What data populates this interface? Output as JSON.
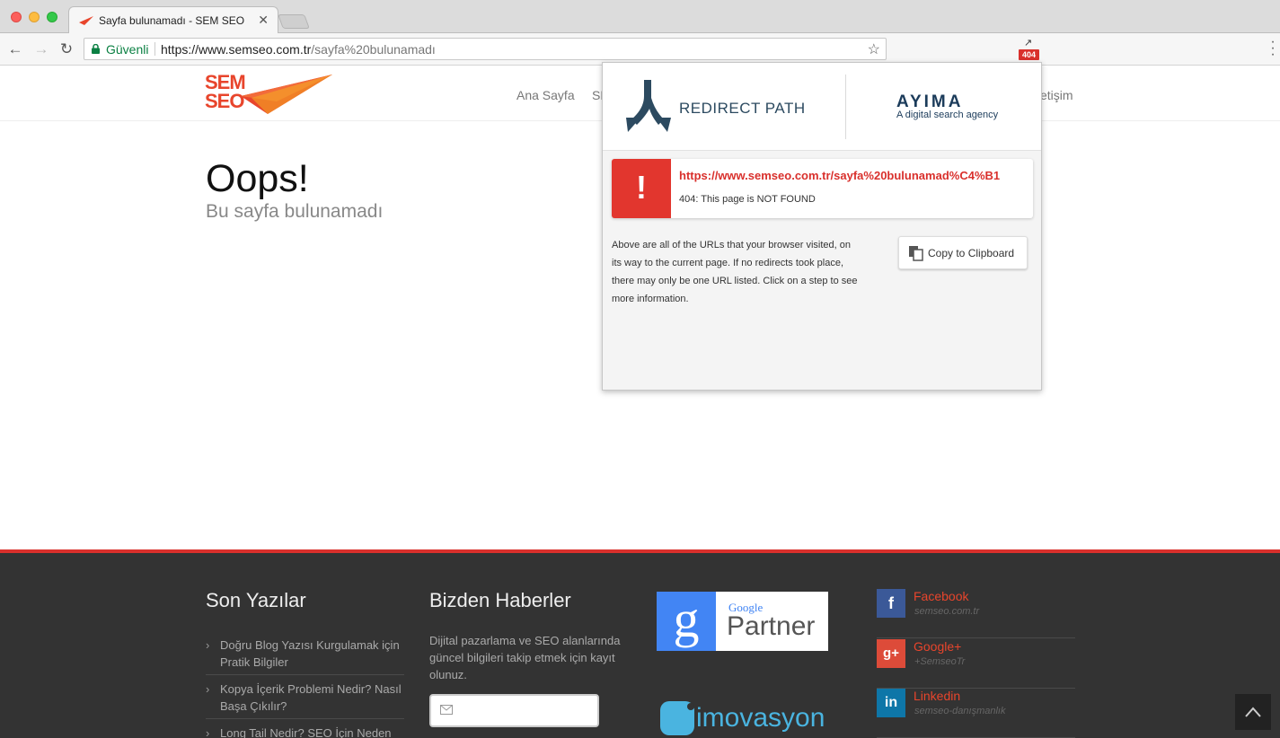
{
  "browser": {
    "tab_title": "Sayfa bulunamadı - SEM SEO",
    "tab_close": "✕",
    "secure_label": "Güvenli",
    "url_base": "https://www.semseo.com.tr",
    "url_path": "/sayfa%20bulunamadı",
    "extension_badge": "404"
  },
  "site": {
    "logo_line1": "SEM",
    "logo_line2": "SEO",
    "nav": [
      "Ana Sayfa",
      "SE",
      "etişim"
    ]
  },
  "main": {
    "title": "Oops!",
    "subtitle": "Bu sayfa bulunamadı"
  },
  "footer": {
    "recent_heading": "Son Yazılar",
    "recent_posts": [
      "Doğru Blog Yazısı Kurgulamak için Pratik Bilgiler",
      "Kopya İçerik Problemi Nedir? Nasıl Başa Çıkılır?",
      "Long Tail Nedir? SEO İçin Neden"
    ],
    "news_heading": "Bizden Haberler",
    "news_text": "Dijital pazarlama ve SEO alanlarında güncel bilgileri takip etmek için kayıt olunuz.",
    "partner_google": "Google",
    "partner_label": "Partner",
    "imovasyon": "imovasyon",
    "social": [
      {
        "icon": "f",
        "name": "Facebook",
        "handle": "semseo.com.tr",
        "color": "#3b5998"
      },
      {
        "icon": "g+",
        "name": "Google+",
        "handle": "+SemseoTr",
        "color": "#dd4b39"
      },
      {
        "icon": "in",
        "name": "Linkedin",
        "handle": "semseo-danışmanlık",
        "color": "#0e76a8"
      }
    ]
  },
  "popup": {
    "title": "REDIRECT PATH",
    "brand": "AYIMA",
    "brand_tagline": "A digital search agency",
    "result_url": "https://www.semseo.com.tr/sayfa%20bulunamad%C4%B1",
    "result_status": "404: This page is NOT FOUND",
    "alert_symbol": "!",
    "description": "Above are all of the URLs that your browser visited, on its way to the current page. If no redirects took place, there may only be one URL listed. Click on a step to see more information.",
    "copy_label": "Copy to Clipboard"
  },
  "colors": {
    "brand_red": "#e8452c",
    "alert_red": "#e2362e",
    "footer_bg": "#333333",
    "secure_green": "#0b8043"
  }
}
